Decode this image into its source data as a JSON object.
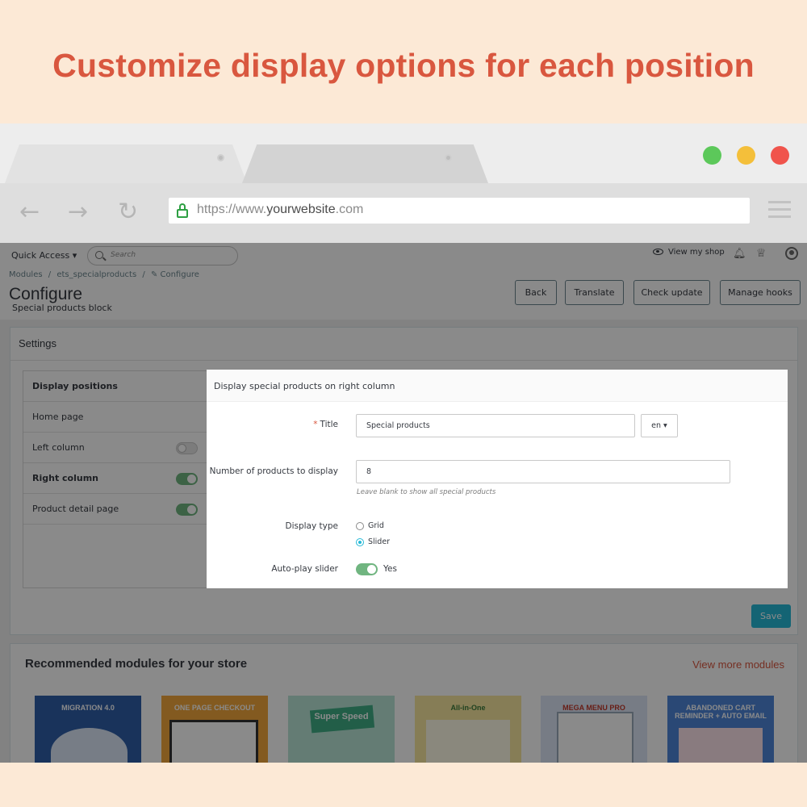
{
  "headline": "Customize display options for each position",
  "browser": {
    "url_prefix": "https://www.",
    "url_domain": "yourwebsite",
    "url_suffix": ".com",
    "traffic_lights": {
      "green": "#5cc85a",
      "yellow": "#f4bf3a",
      "red": "#f0544c"
    }
  },
  "admin": {
    "quick_access": "Quick Access ▾",
    "search_placeholder": "Search",
    "view_shop": "View my shop",
    "breadcrumb": [
      "Modules",
      "/",
      "ets_specialproducts",
      "/",
      "✎ Configure"
    ],
    "page_title": "Configure",
    "page_subtitle": "Special products block",
    "buttons": {
      "back": "Back",
      "translate": "Translate",
      "check_update": "Check update",
      "manage_hooks": "Manage hooks"
    },
    "settings_title": "Settings",
    "sidebar": {
      "header": "Display positions",
      "items": [
        {
          "label": "Home page",
          "toggle": null
        },
        {
          "label": "Left column",
          "toggle": false
        },
        {
          "label": "Right column",
          "toggle": true
        },
        {
          "label": "Product detail page",
          "toggle": true
        }
      ]
    },
    "save": "Save",
    "recommended_title": "Recommended modules for your store",
    "view_more": "View more modules",
    "thumbs": [
      "MIGRATION 4.0",
      "ONE PAGE CHECKOUT",
      "Super Speed",
      "All-in-One",
      "MEGA MENU PRO",
      "ABANDONED CART REMINDER + AUTO EMAIL"
    ]
  },
  "modal": {
    "title": "Display special products on right column",
    "title_label": "Title",
    "title_required": "*",
    "title_value": "Special products",
    "lang": "en ▾",
    "count_label": "Number of products to display",
    "count_value": "8",
    "count_hint": "Leave blank to show all special products",
    "display_type_label": "Display type",
    "display_options": [
      "Grid",
      "Slider"
    ],
    "display_selected": "Slider",
    "autoplay_label": "Auto-play slider",
    "autoplay_value": "Yes",
    "autoplay_on": true
  },
  "colors": {
    "accent": "#d9573f",
    "primary": "#25b9d7",
    "toggle_on": "#70b580"
  }
}
